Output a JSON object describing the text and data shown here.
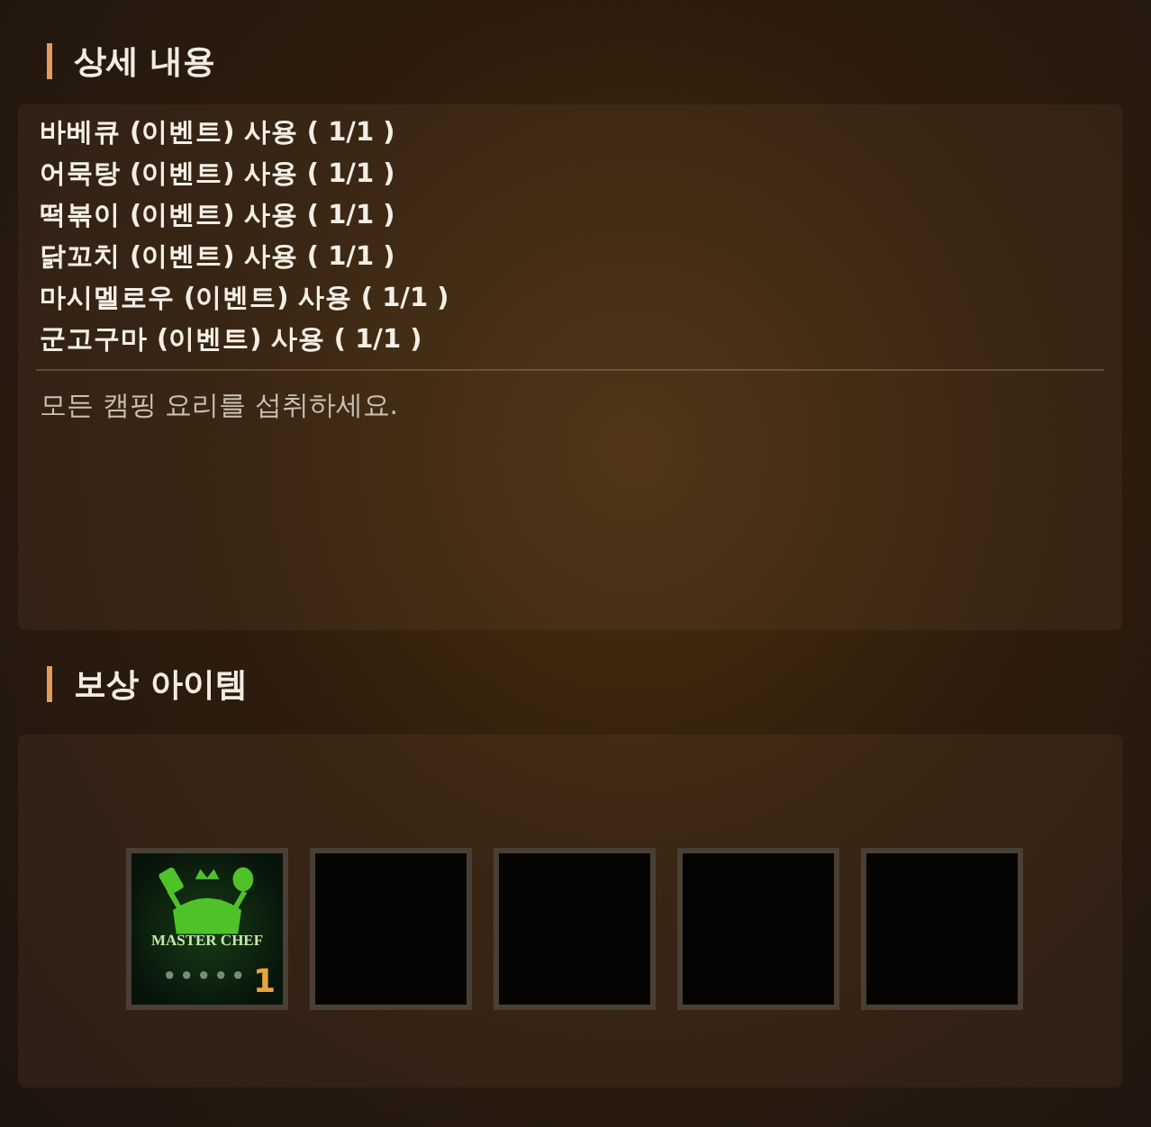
{
  "details": {
    "title": "상세 내용",
    "conditions": [
      "바베큐 (이벤트) 사용 ( 1/1 )",
      "어묵탕 (이벤트) 사용 ( 1/1 )",
      "떡볶이 (이벤트) 사용 ( 1/1 )",
      "닭꼬치 (이벤트) 사용 ( 1/1 )",
      "마시멜로우 (이벤트) 사용 ( 1/1 )",
      "군고구마 (이벤트) 사용 ( 1/1 )"
    ],
    "description": "모든 캠핑 요리를 섭취하세요."
  },
  "rewards": {
    "title": "보상 아이템",
    "slots": [
      {
        "kind": "item",
        "label": "MASTER CHEF",
        "count": "1"
      },
      {
        "kind": "empty"
      },
      {
        "kind": "empty"
      },
      {
        "kind": "empty"
      },
      {
        "kind": "empty"
      }
    ]
  }
}
